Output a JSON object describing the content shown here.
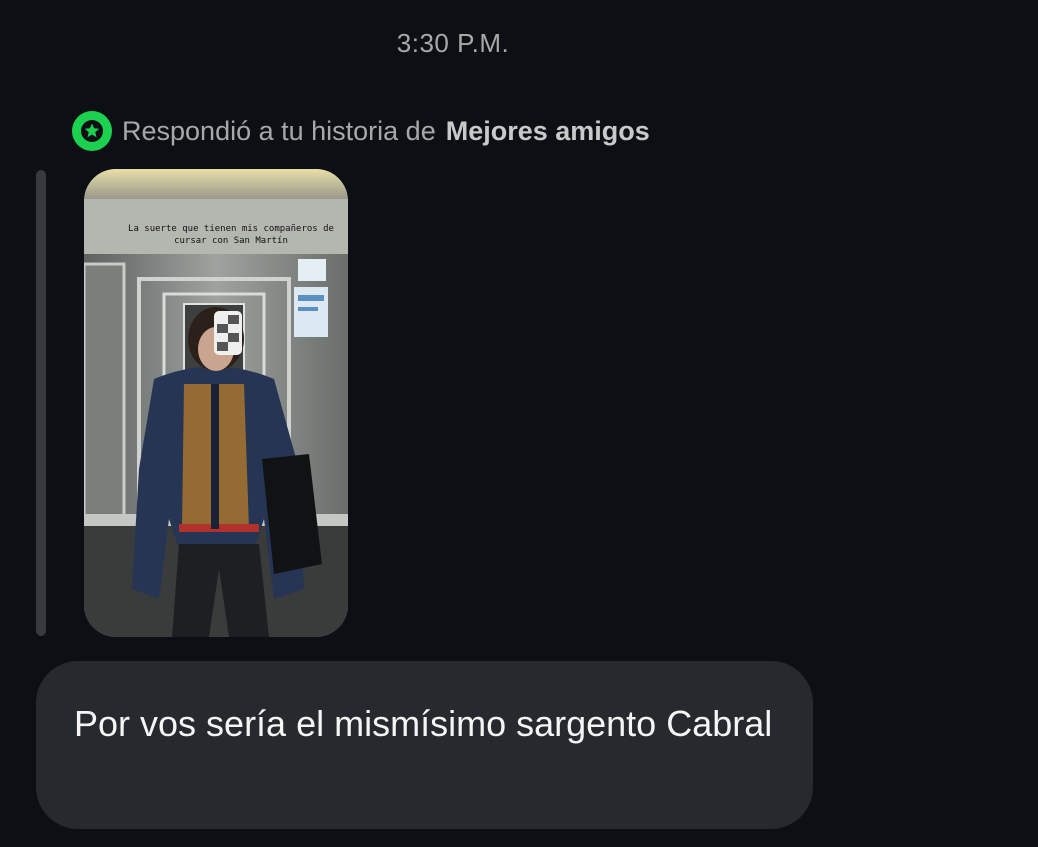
{
  "timestamp": "3:30 P.M.",
  "reply_header": {
    "prefix": "Respondió a tu historia de",
    "list_name": "Mejores amigos",
    "badge_icon": "star-icon",
    "badge_color": "#1cd14f"
  },
  "story": {
    "caption": "La suerte que tienen mis compañeros de cursar con San Martín"
  },
  "message": {
    "text": "Por vos sería el mismísimo sargento Cabral"
  },
  "colors": {
    "background": "#0c1014",
    "bubble": "#262a2f",
    "muted_text": "#a8a8a8"
  }
}
